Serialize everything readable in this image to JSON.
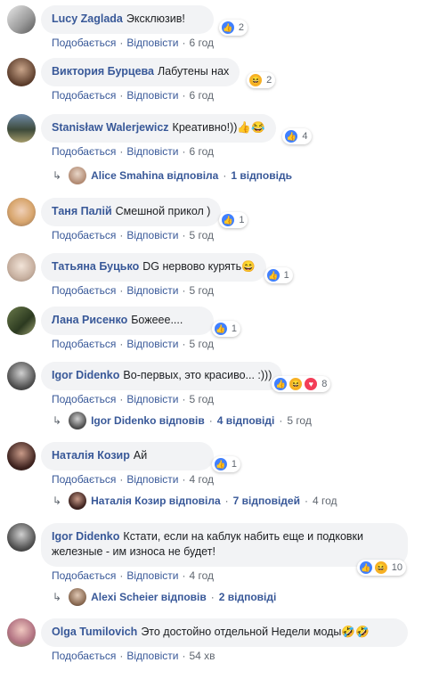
{
  "labels": {
    "like": "Подобається",
    "reply": "Відповісти",
    "dot": "·"
  },
  "comments": [
    {
      "name": "Lucy Zaglada",
      "text": "Эксклюзив!",
      "emoji": "",
      "reactions": "2",
      "time": "6 год"
    },
    {
      "name": "Виктория Бурцева",
      "text": "Лабутены нах",
      "emoji": "",
      "reactions": "2",
      "time": "6 год"
    },
    {
      "name": "Stanisław Walerjewicz",
      "text": "Креативно!))",
      "emoji": "👍😂",
      "reactions": "4",
      "time": "6 год"
    },
    {
      "name": "Таня Палій",
      "text": "Смешной прикол )",
      "emoji": "",
      "reactions": "1",
      "time": "5 год"
    },
    {
      "name": "Татьяна Буцько",
      "text": "DG нервово курять",
      "emoji": "😄",
      "reactions": "1",
      "time": "5 год"
    },
    {
      "name": "Лана Рисенко",
      "text": "Божеее....",
      "emoji": "",
      "reactions": "1",
      "time": "5 год"
    },
    {
      "name": "Igor Didenko",
      "text": "Во-первых, это красиво... :)))",
      "emoji": "",
      "reactions": "8",
      "time": "5 год"
    },
    {
      "name": "Наталія Козир",
      "text": "Ай",
      "emoji": "",
      "reactions": "1",
      "time": "4 год"
    },
    {
      "name": "Igor Didenko",
      "text": "Кстати, если на каблук набить еще и подковки",
      "text2": "железные - им износа не будет!",
      "emoji": "",
      "reactions": "10",
      "time": "4 год"
    },
    {
      "name": "Olga Tumilovich",
      "text": "Это достойно отдельной Недели моды",
      "emoji": "🤣🤣",
      "reactions": "",
      "time": "54 хв"
    }
  ],
  "replies": [
    {
      "name": "Alice Smahina відповіла",
      "count": "1 відповідь",
      "time": ""
    },
    {
      "name": "Igor Didenko відповів",
      "count": "4 відповіді",
      "time": "5 год"
    },
    {
      "name": "Наталія Козир відповіла",
      "count": "7 відповідей",
      "time": "4 год"
    },
    {
      "name": "Alexi Scheier відповів",
      "count": "2 відповіді",
      "time": ""
    }
  ],
  "colors": {
    "link": "#385898",
    "bubble": "#f2f3f5",
    "like": "#4080ff",
    "haha": "#f7b125",
    "love": "#f33e58"
  }
}
